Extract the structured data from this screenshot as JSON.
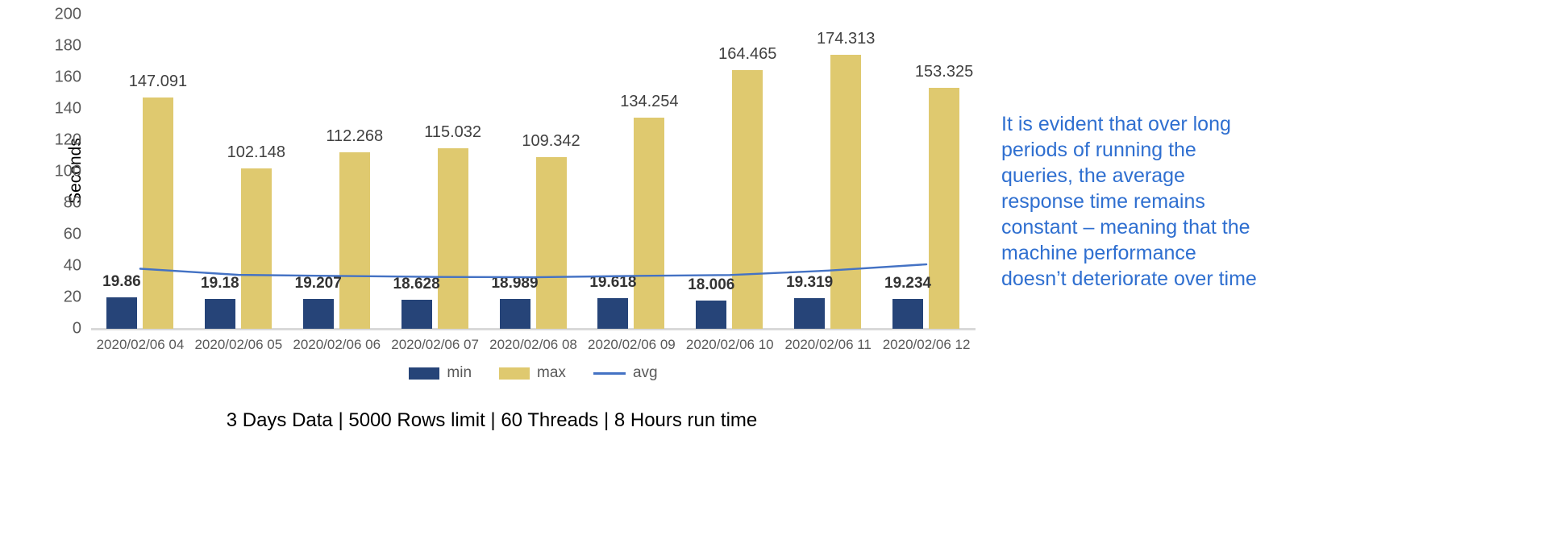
{
  "chart_data": {
    "type": "bar",
    "title": "",
    "xlabel": "",
    "ylabel": "Seconds",
    "ylim": [
      0,
      200
    ],
    "yticks": [
      200,
      180,
      160,
      140,
      120,
      100,
      80,
      60,
      40,
      20,
      0
    ],
    "grid": false,
    "legend_position": "bottom",
    "categories": [
      "2020/02/06 04",
      "2020/02/06 05",
      "2020/02/06 06",
      "2020/02/06 07",
      "2020/02/06 08",
      "2020/02/06 09",
      "2020/02/06 10",
      "2020/02/06 11",
      "2020/02/06 12"
    ],
    "series": [
      {
        "name": "min",
        "type": "bar",
        "color": "#264478",
        "values": [
          19.86,
          19.18,
          19.207,
          18.628,
          18.989,
          19.618,
          18.006,
          19.319,
          19.234
        ],
        "labels": [
          "19.86",
          "19.18",
          "19.207",
          "18.628",
          "18.989",
          "19.618",
          "18.006",
          "19.319",
          "19.234"
        ]
      },
      {
        "name": "max",
        "type": "bar",
        "color": "#dfc96f",
        "values": [
          147.091,
          102.148,
          112.268,
          115.032,
          109.342,
          134.254,
          164.465,
          174.313,
          153.325
        ],
        "labels": [
          "147.091",
          "102.148",
          "112.268",
          "115.032",
          "109.342",
          "134.254",
          "164.465",
          "174.313",
          "153.325"
        ]
      },
      {
        "name": "avg",
        "type": "line",
        "color": "#4472c4",
        "values": [
          38.2,
          34.3,
          33.6,
          33.0,
          32.8,
          33.6,
          34.2,
          37.0,
          41.0
        ],
        "labels": []
      }
    ]
  },
  "legend": {
    "items": [
      {
        "label": "min",
        "marker": "bar-swatch",
        "color": "#264478"
      },
      {
        "label": "max",
        "marker": "bar-swatch",
        "color": "#dfc96f"
      },
      {
        "label": "avg",
        "marker": "line-swatch",
        "color": "#4472c4"
      }
    ]
  },
  "footnote": {
    "text": "3 Days Data |  5000 Rows limit  |  60 Threads  |  8 Hours run time"
  },
  "annotation": {
    "text": "It is evident that over long periods of running the queries, the average response time remains constant – meaning that the machine performance doesn’t deteriorate over time",
    "color": "#2f6fd0"
  }
}
